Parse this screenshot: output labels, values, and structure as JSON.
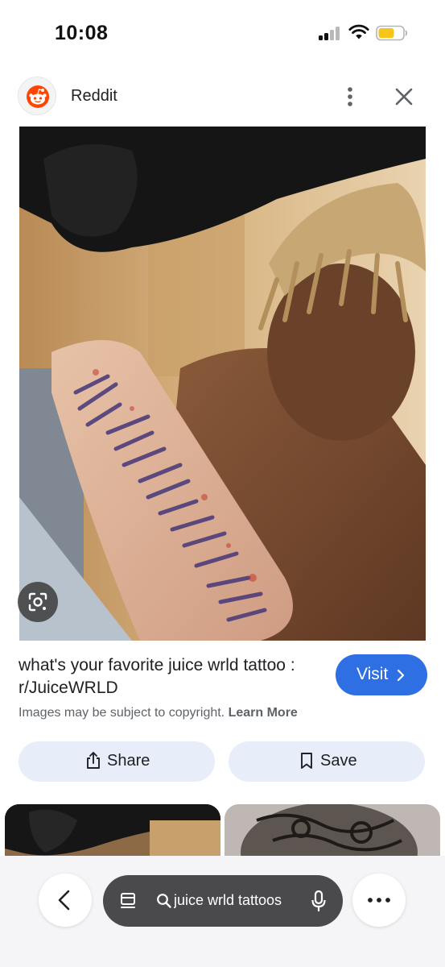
{
  "status_bar": {
    "time": "10:08",
    "signal_icon": "cellular-signal-icon",
    "wifi_icon": "wifi-icon",
    "battery_icon": "battery-low-power-icon",
    "battery_color": "#f5c518"
  },
  "header": {
    "site_name": "Reddit",
    "logo_icon": "reddit-logo-icon",
    "logo_color": "#ff4500",
    "more_icon": "more-vertical-icon",
    "close_icon": "close-icon"
  },
  "image": {
    "visual_search_icon": "camera-lens-icon"
  },
  "result": {
    "title": "what's your favorite juice wrld tattoo : r/JuiceWRLD",
    "visit_label": "Visit",
    "copyright_text": "Images may be subject to copyright.",
    "learn_more_label": "Learn More"
  },
  "actions": {
    "share_label": "Share",
    "share_icon": "share-icon",
    "save_label": "Save",
    "save_icon": "bookmark-icon"
  },
  "bottom_bar": {
    "back_icon": "chevron-left-icon",
    "tabs_icon": "tabs-icon",
    "search_icon": "search-icon",
    "search_text": "juice wrld tattoos",
    "mic_icon": "microphone-icon",
    "menu_icon": "more-horizontal-icon"
  },
  "colors": {
    "accent": "#2f6fe4",
    "action_bg": "#e8eef9",
    "pill_bg": "#4a4a4c"
  }
}
